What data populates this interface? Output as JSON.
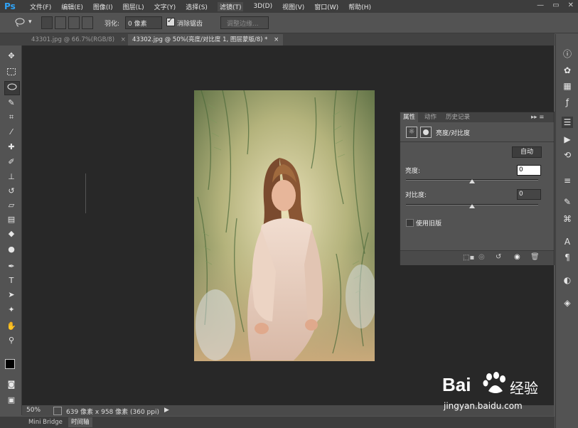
{
  "app": {
    "logo": "Ps"
  },
  "menu": [
    "文件(F)",
    "编辑(E)",
    "图像(I)",
    "图层(L)",
    "文字(Y)",
    "选择(S)",
    "滤镜(T)",
    "3D(D)",
    "视图(V)",
    "窗口(W)",
    "帮助(H)"
  ],
  "window_controls": {
    "minimize": "—",
    "restore": "▭",
    "close": "✕"
  },
  "options": {
    "feather_label": "羽化:",
    "feather_value": "0 像素",
    "antialias_label": "消除锯齿",
    "antialias_checked": "✓",
    "refine_edge": "调整边缘..."
  },
  "tabs": [
    {
      "label": "43301.jpg @ 66.7%(RGB/8)",
      "close": "×"
    },
    {
      "label": "43302.jpg @ 50%(亮度/对比度 1, 图层蒙版/8) *",
      "close": "×"
    }
  ],
  "panel": {
    "tabs": [
      "属性",
      "动作",
      "历史记录"
    ],
    "header": "亮度/对比度",
    "auto_button": "自动",
    "brightness_label": "亮度:",
    "brightness_value": "0",
    "brightness_slider": 0.5,
    "contrast_label": "对比度:",
    "contrast_value": "0",
    "contrast_slider": 0.5,
    "legacy_label": "使用旧版"
  },
  "status": {
    "zoom": "50%",
    "doc_info": "639 像素 x 958 像素 (360 ppi)"
  },
  "bottom_tabs": [
    "Mini Bridge",
    "时间轴"
  ],
  "watermark": {
    "brand": "Bai",
    "brand_cn": "经验",
    "url": "jingyan.baidu.com"
  },
  "colors": {
    "accent": "#2fa3f7",
    "panel_bg": "#535353",
    "canvas_bg": "#282828"
  }
}
